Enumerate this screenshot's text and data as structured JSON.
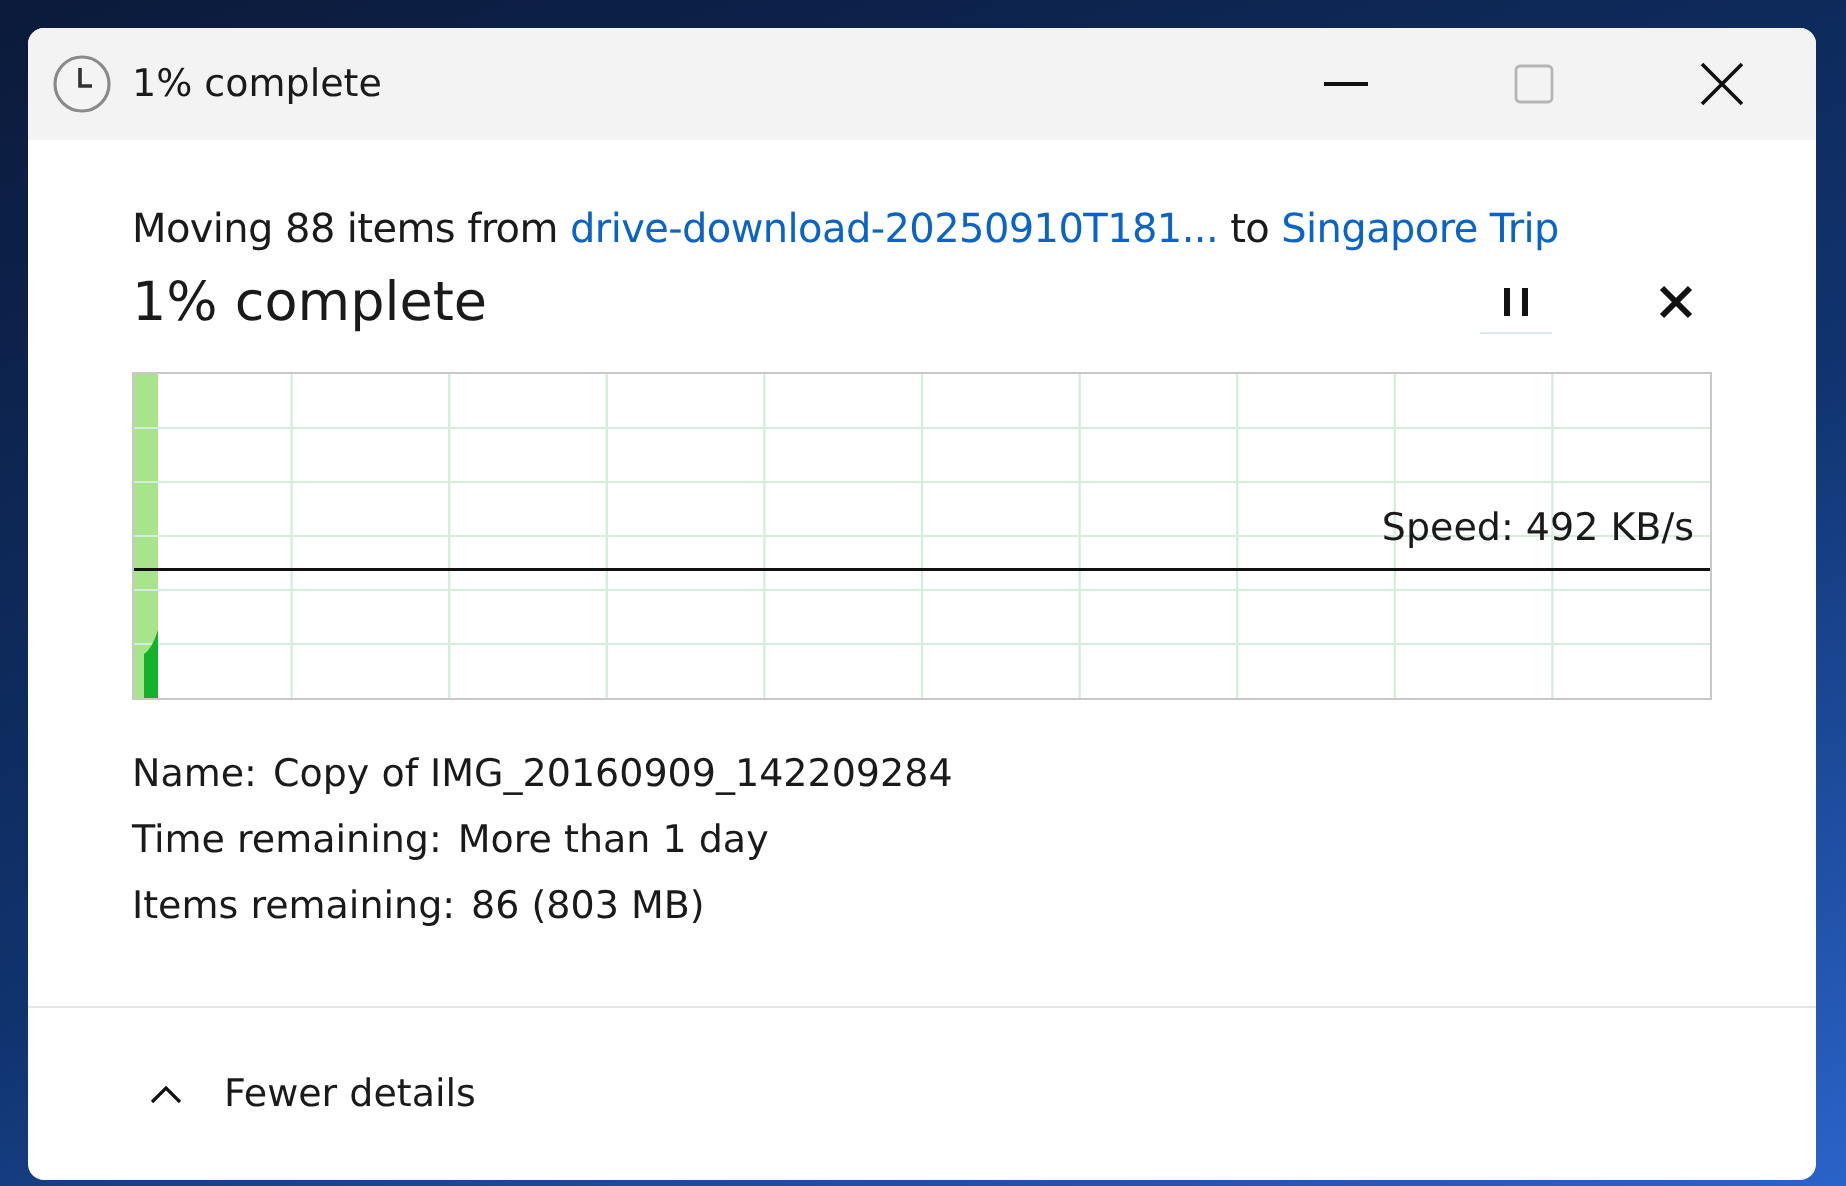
{
  "window": {
    "title": "1% complete"
  },
  "summary": {
    "prefix": "Moving 88 items from",
    "source": "drive-download-20250910T181...",
    "joiner": "to",
    "destination": "Singapore Trip"
  },
  "progress": {
    "heading": "1% complete",
    "level": 0.01,
    "speed": "Speed: 492 KB/s"
  },
  "details": [
    {
      "label": "Name:",
      "value": "Copy of IMG_20160909_142209284"
    },
    {
      "label": "Time remaining:",
      "value": "More than 1 day"
    },
    {
      "label": "Items remaining:",
      "value": "86 (803 MB)"
    }
  ],
  "footer": {
    "toggle": "Fewer details",
    "expanded": true
  }
}
